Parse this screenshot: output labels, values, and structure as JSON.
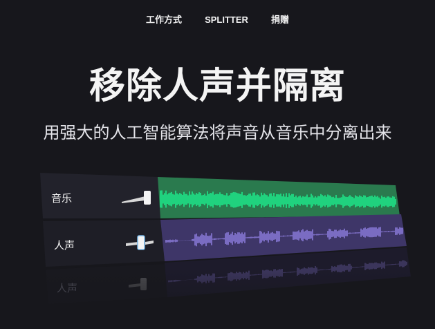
{
  "nav": {
    "items": [
      {
        "label": "工作方式"
      },
      {
        "label": "SPLITTER"
      },
      {
        "label": "捐赠"
      }
    ]
  },
  "hero": {
    "title": "移除人声并隔离",
    "subtitle": "用强大的人工智能算法将声音从音乐中分离出来"
  },
  "mixer": {
    "tracks": [
      {
        "label": "音乐",
        "color": "#1ee88a",
        "panel_color": "#2a7a4e"
      },
      {
        "label": "人声",
        "color": "#8a7ad8",
        "panel_color": "#3e3668"
      }
    ]
  },
  "colors": {
    "background": "#17171c",
    "label_panel": "#22222b",
    "music_wave": "#1ee88a",
    "vocal_wave": "#8a7ad8"
  }
}
